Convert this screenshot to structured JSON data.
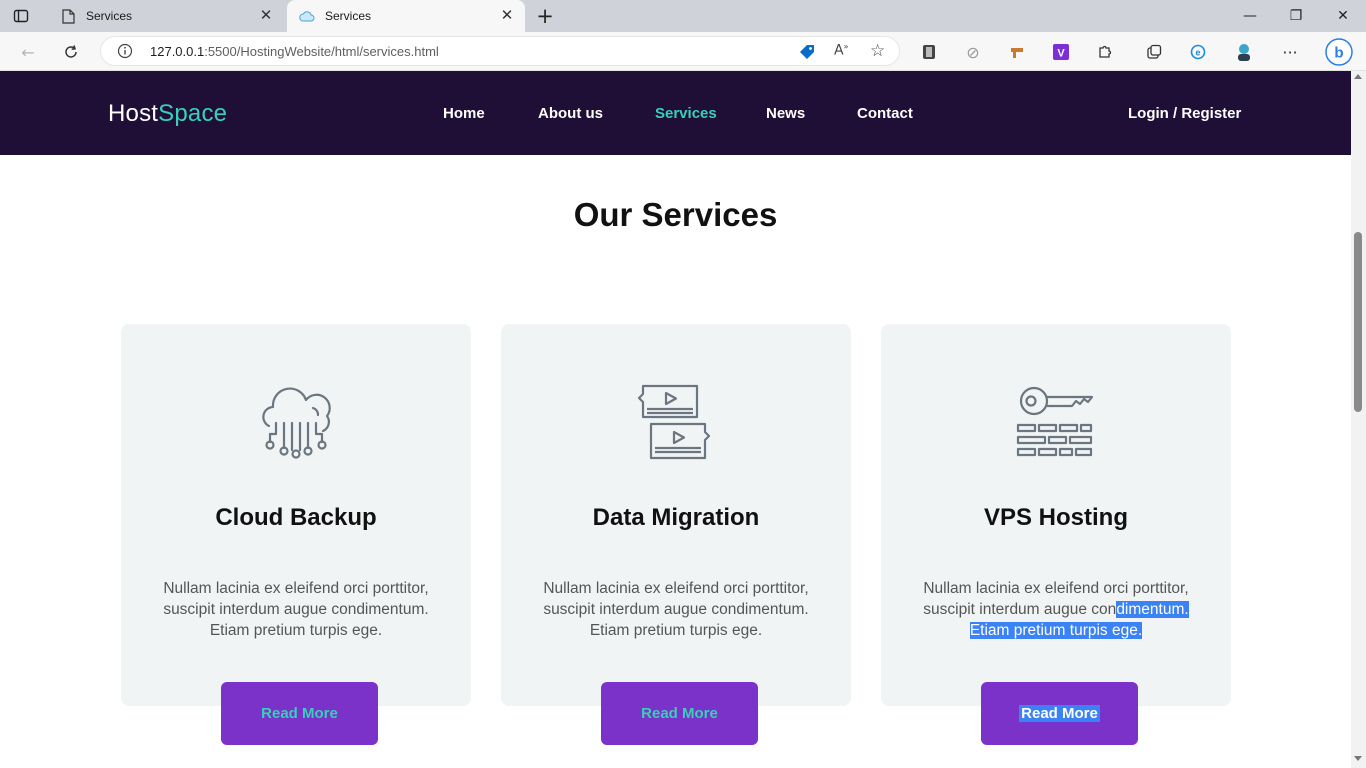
{
  "browser": {
    "tabs": [
      {
        "title": "Services"
      },
      {
        "title": "Services"
      }
    ],
    "url_host": "127.0.0.1",
    "url_rest": ":5500/HostingWebsite/html/services.html"
  },
  "site": {
    "logo_main": "Host",
    "logo_accent": "Space",
    "nav": [
      "Home",
      "About us",
      "Services",
      "News",
      "Contact"
    ],
    "login": "Login / Register",
    "section_title": "Our Services",
    "cards": [
      {
        "title": "Cloud Backup",
        "desc_line1": "Nullam lacinia ex eleifend orci porttitor,",
        "desc_line2": "suscipit interdum augue condimentum.",
        "desc_line3": "Etiam pretium turpis ege.",
        "button": "Read More",
        "icon": "cloud-network-icon"
      },
      {
        "title": "Data Migration",
        "desc_line1": "Nullam lacinia ex eleifend orci porttitor,",
        "desc_line2": "suscipit interdum augue condimentum.",
        "desc_line3": "Etiam pretium turpis ege.",
        "button": "Read More",
        "icon": "video-transfer-icon"
      },
      {
        "title": "VPS Hosting",
        "desc_line1": "Nullam lacinia ex eleifend orci porttitor,",
        "desc_line2a": "suscipit interdum augue con",
        "desc_line2b": "dimentum.",
        "desc_line3": "Etiam pretium turpis ege.",
        "button": "Read More",
        "icon": "key-firewall-icon"
      }
    ]
  },
  "colors": {
    "header_bg": "#1f0f36",
    "accent": "#36d1b8",
    "button_bg": "#7a32c8",
    "card_bg": "#f1f4f5",
    "selection": "#3b82f6"
  }
}
